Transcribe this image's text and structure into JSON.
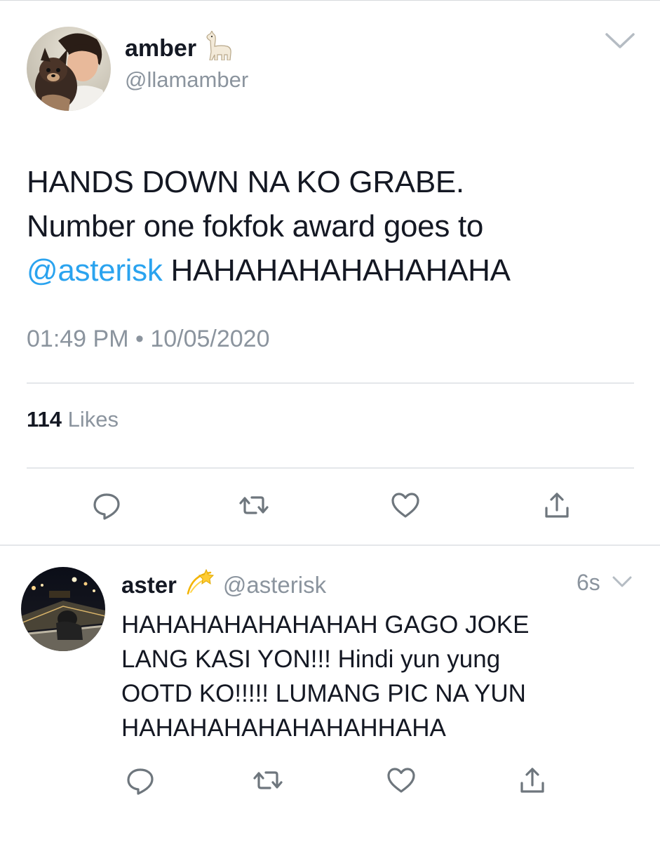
{
  "main_tweet": {
    "author": {
      "display_name": "amber",
      "name_emoji": "llama-emoji",
      "handle": "@llamamber"
    },
    "text": {
      "line1": "HANDS DOWN NA KO GRABE.",
      "line2": "Number one fokfok award goes to",
      "mention": "@asterisk",
      "line3_rest": " HAHAHAHAHAHAHAHA"
    },
    "timestamp": "01:49 PM • 10/05/2020",
    "likes_count": "114",
    "likes_label": " Likes",
    "actions": [
      "reply-icon",
      "retweet-icon",
      "like-icon",
      "share-icon"
    ]
  },
  "reply": {
    "author": {
      "display_name": "aster",
      "name_emoji": "dizzy-emoji",
      "handle": "@asterisk"
    },
    "time": "6s",
    "lines": [
      "HAHAHAHAHAHAHAH GAGO JOKE",
      "LANG KASI YON!!! Hindi yun yung",
      "OOTD KO!!!!! LUMANG PIC NA YUN",
      "HAHAHAHAHAHAHAHHAHA"
    ],
    "actions": [
      "reply-icon",
      "retweet-icon",
      "like-icon",
      "share-icon"
    ]
  },
  "colors": {
    "mention": "#2aa3ef",
    "secondary_text": "#8b949e",
    "icon": "#6e767d",
    "divider": "#e4e7ea"
  }
}
